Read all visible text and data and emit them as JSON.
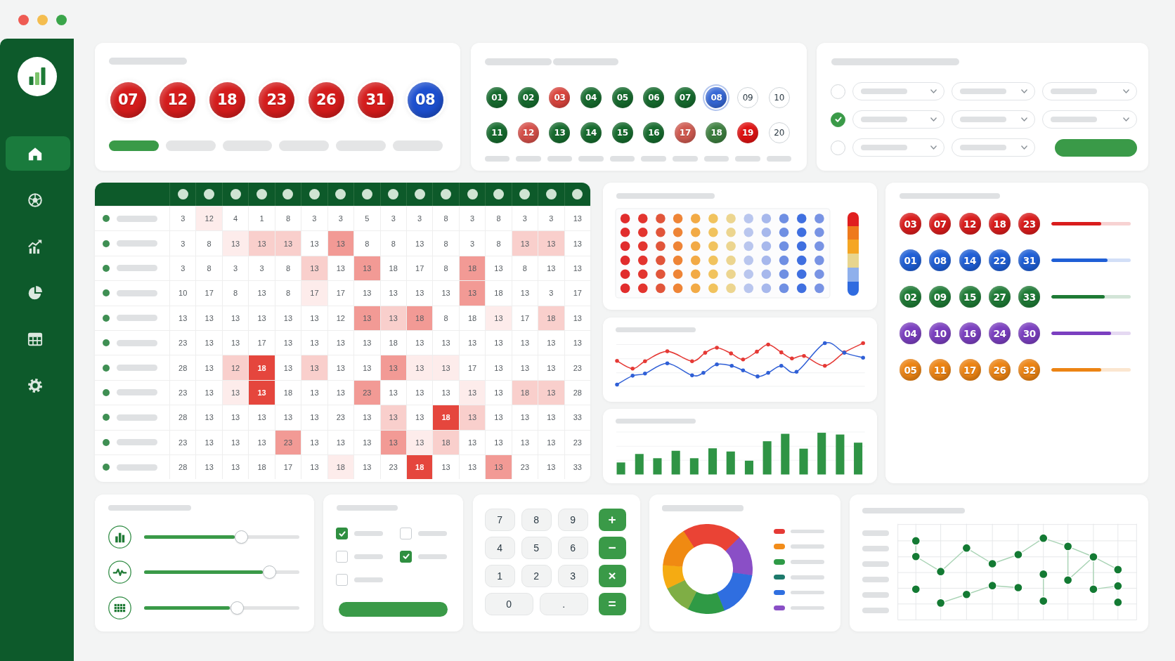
{
  "sidebar": {
    "items": [
      {
        "kind": "home",
        "selected": true
      },
      {
        "kind": "ball",
        "selected": false
      },
      {
        "kind": "trend",
        "selected": false
      },
      {
        "kind": "pie",
        "selected": false
      },
      {
        "kind": "table",
        "selected": false
      },
      {
        "kind": "settings",
        "selected": false
      }
    ]
  },
  "draw_card": {
    "balls": [
      {
        "number": "07",
        "color": "#d41c1c"
      },
      {
        "number": "12",
        "color": "#d41c1c"
      },
      {
        "number": "18",
        "color": "#d41c1c"
      },
      {
        "number": "23",
        "color": "#d41c1c"
      },
      {
        "number": "26",
        "color": "#d41c1c"
      },
      {
        "number": "31",
        "color": "#d41c1c"
      },
      {
        "number": "08",
        "color": "#1d4fcf"
      }
    ],
    "tabs": [
      {
        "selected": true
      },
      {
        "selected": false
      },
      {
        "selected": false
      },
      {
        "selected": false
      },
      {
        "selected": false
      },
      {
        "selected": false
      }
    ]
  },
  "number_grid": {
    "balls": [
      {
        "number": "01",
        "color": "#166b2e",
        "selected": false
      },
      {
        "number": "02",
        "color": "#166b2e",
        "selected": false
      },
      {
        "number": "03",
        "color": "#d9443d",
        "selected": false
      },
      {
        "number": "04",
        "color": "#166b2e",
        "selected": false
      },
      {
        "number": "05",
        "color": "#166b2e",
        "selected": false
      },
      {
        "number": "06",
        "color": "#166b2e",
        "selected": false
      },
      {
        "number": "07",
        "color": "#166b2e",
        "selected": false
      },
      {
        "number": "08",
        "color": "#3567d6",
        "selected": true
      },
      {
        "number": "09",
        "color": "#ffffff",
        "selected": false
      },
      {
        "number": "10",
        "color": "#ffffff",
        "selected": false
      },
      {
        "number": "11",
        "color": "#166b2e",
        "selected": false
      },
      {
        "number": "12",
        "color": "#d6504a",
        "selected": false
      },
      {
        "number": "13",
        "color": "#166b2e",
        "selected": false
      },
      {
        "number": "14",
        "color": "#166b2e",
        "selected": false
      },
      {
        "number": "15",
        "color": "#166b2e",
        "selected": false
      },
      {
        "number": "16",
        "color": "#166b2e",
        "selected": false
      },
      {
        "number": "17",
        "color": "#cf5a50",
        "selected": false
      },
      {
        "number": "18",
        "color": "#3d7f3f",
        "selected": false
      },
      {
        "number": "19",
        "color": "#e01212",
        "selected": false
      },
      {
        "number": "20",
        "color": "#ffffff",
        "selected": false
      }
    ]
  },
  "filter_card": {
    "rows": [
      {
        "selected": false,
        "fields": [
          {
            "kind": "dropdown"
          },
          {
            "kind": "dropdown"
          },
          {
            "kind": "dropdown"
          }
        ]
      },
      {
        "selected": true,
        "fields": [
          {
            "kind": "dropdown"
          },
          {
            "kind": "dropdown"
          },
          {
            "kind": "dropdown"
          }
        ]
      },
      {
        "selected": false,
        "fields": [
          {
            "kind": "dropdown"
          },
          {
            "kind": "dropdown"
          },
          {
            "kind": "button"
          }
        ]
      }
    ]
  },
  "table": {
    "rows": [
      {
        "cells": [
          {
            "value": "3",
            "color": "#ffffff"
          },
          {
            "value": "12",
            "color": "#fdeceb"
          },
          {
            "value": "4",
            "color": "#ffffff"
          },
          {
            "value": "1",
            "color": "#ffffff"
          },
          {
            "value": "8",
            "color": "#ffffff"
          },
          {
            "value": "3",
            "color": "#ffffff"
          },
          {
            "value": "3",
            "color": "#ffffff"
          },
          {
            "value": "5",
            "color": "#ffffff"
          },
          {
            "value": "3",
            "color": "#ffffff"
          },
          {
            "value": "3",
            "color": "#ffffff"
          },
          {
            "value": "8",
            "color": "#ffffff"
          },
          {
            "value": "3",
            "color": "#ffffff"
          },
          {
            "value": "8",
            "color": "#ffffff"
          },
          {
            "value": "3",
            "color": "#ffffff"
          },
          {
            "value": "3",
            "color": "#ffffff"
          },
          {
            "value": "13",
            "color": "#ffffff"
          }
        ]
      },
      {
        "cells": [
          {
            "value": "3",
            "color": "#ffffff"
          },
          {
            "value": "8",
            "color": "#ffffff"
          },
          {
            "value": "13",
            "color": "#fdeceb"
          },
          {
            "value": "13",
            "color": "#f9cfcc"
          },
          {
            "value": "13",
            "color": "#f9cfcc"
          },
          {
            "value": "13",
            "color": "#ffffff"
          },
          {
            "value": "13",
            "color": "#f29a95"
          },
          {
            "value": "8",
            "color": "#ffffff"
          },
          {
            "value": "8",
            "color": "#ffffff"
          },
          {
            "value": "13",
            "color": "#ffffff"
          },
          {
            "value": "8",
            "color": "#ffffff"
          },
          {
            "value": "3",
            "color": "#ffffff"
          },
          {
            "value": "8",
            "color": "#ffffff"
          },
          {
            "value": "13",
            "color": "#f9cfcc"
          },
          {
            "value": "13",
            "color": "#f9cfcc"
          },
          {
            "value": "13",
            "color": "#ffffff"
          }
        ]
      },
      {
        "cells": [
          {
            "value": "3",
            "color": "#ffffff"
          },
          {
            "value": "8",
            "color": "#ffffff"
          },
          {
            "value": "3",
            "color": "#ffffff"
          },
          {
            "value": "3",
            "color": "#ffffff"
          },
          {
            "value": "8",
            "color": "#ffffff"
          },
          {
            "value": "13",
            "color": "#f9cfcc"
          },
          {
            "value": "13",
            "color": "#ffffff"
          },
          {
            "value": "13",
            "color": "#f29a95"
          },
          {
            "value": "18",
            "color": "#ffffff"
          },
          {
            "value": "17",
            "color": "#ffffff"
          },
          {
            "value": "8",
            "color": "#ffffff"
          },
          {
            "value": "18",
            "color": "#f29a95"
          },
          {
            "value": "13",
            "color": "#ffffff"
          },
          {
            "value": "8",
            "color": "#ffffff"
          },
          {
            "value": "13",
            "color": "#ffffff"
          },
          {
            "value": "13",
            "color": "#ffffff"
          }
        ]
      },
      {
        "cells": [
          {
            "value": "10",
            "color": "#ffffff"
          },
          {
            "value": "17",
            "color": "#ffffff"
          },
          {
            "value": "8",
            "color": "#ffffff"
          },
          {
            "value": "13",
            "color": "#ffffff"
          },
          {
            "value": "8",
            "color": "#ffffff"
          },
          {
            "value": "17",
            "color": "#fdeceb"
          },
          {
            "value": "17",
            "color": "#ffffff"
          },
          {
            "value": "13",
            "color": "#ffffff"
          },
          {
            "value": "13",
            "color": "#ffffff"
          },
          {
            "value": "13",
            "color": "#ffffff"
          },
          {
            "value": "13",
            "color": "#ffffff"
          },
          {
            "value": "13",
            "color": "#f29a95"
          },
          {
            "value": "18",
            "color": "#ffffff"
          },
          {
            "value": "13",
            "color": "#ffffff"
          },
          {
            "value": "3",
            "color": "#ffffff"
          },
          {
            "value": "17",
            "color": "#ffffff"
          }
        ]
      },
      {
        "cells": [
          {
            "value": "13",
            "color": "#ffffff"
          },
          {
            "value": "13",
            "color": "#ffffff"
          },
          {
            "value": "13",
            "color": "#ffffff"
          },
          {
            "value": "13",
            "color": "#ffffff"
          },
          {
            "value": "13",
            "color": "#ffffff"
          },
          {
            "value": "13",
            "color": "#ffffff"
          },
          {
            "value": "12",
            "color": "#ffffff"
          },
          {
            "value": "13",
            "color": "#f29a95"
          },
          {
            "value": "13",
            "color": "#f9cfcc"
          },
          {
            "value": "18",
            "color": "#f29a95"
          },
          {
            "value": "8",
            "color": "#ffffff"
          },
          {
            "value": "18",
            "color": "#ffffff"
          },
          {
            "value": "13",
            "color": "#fdeceb"
          },
          {
            "value": "17",
            "color": "#ffffff"
          },
          {
            "value": "18",
            "color": "#f9cfcc"
          },
          {
            "value": "13",
            "color": "#ffffff"
          }
        ]
      },
      {
        "cells": [
          {
            "value": "23",
            "color": "#ffffff"
          },
          {
            "value": "13",
            "color": "#ffffff"
          },
          {
            "value": "13",
            "color": "#ffffff"
          },
          {
            "value": "17",
            "color": "#ffffff"
          },
          {
            "value": "13",
            "color": "#ffffff"
          },
          {
            "value": "13",
            "color": "#ffffff"
          },
          {
            "value": "13",
            "color": "#ffffff"
          },
          {
            "value": "13",
            "color": "#ffffff"
          },
          {
            "value": "18",
            "color": "#ffffff"
          },
          {
            "value": "13",
            "color": "#ffffff"
          },
          {
            "value": "13",
            "color": "#ffffff"
          },
          {
            "value": "13",
            "color": "#ffffff"
          },
          {
            "value": "13",
            "color": "#ffffff"
          },
          {
            "value": "13",
            "color": "#ffffff"
          },
          {
            "value": "13",
            "color": "#ffffff"
          },
          {
            "value": "13",
            "color": "#ffffff"
          }
        ]
      },
      {
        "cells": [
          {
            "value": "28",
            "color": "#ffffff"
          },
          {
            "value": "13",
            "color": "#ffffff"
          },
          {
            "value": "12",
            "color": "#f9cfcc"
          },
          {
            "value": "18",
            "color": "#e5463d"
          },
          {
            "value": "13",
            "color": "#ffffff"
          },
          {
            "value": "13",
            "color": "#f9cfcc"
          },
          {
            "value": "13",
            "color": "#ffffff"
          },
          {
            "value": "13",
            "color": "#ffffff"
          },
          {
            "value": "13",
            "color": "#f29a95"
          },
          {
            "value": "13",
            "color": "#fdeceb"
          },
          {
            "value": "13",
            "color": "#fdeceb"
          },
          {
            "value": "17",
            "color": "#ffffff"
          },
          {
            "value": "13",
            "color": "#ffffff"
          },
          {
            "value": "13",
            "color": "#ffffff"
          },
          {
            "value": "13",
            "color": "#ffffff"
          },
          {
            "value": "23",
            "color": "#ffffff"
          }
        ]
      },
      {
        "cells": [
          {
            "value": "23",
            "color": "#ffffff"
          },
          {
            "value": "13",
            "color": "#ffffff"
          },
          {
            "value": "13",
            "color": "#fdeceb"
          },
          {
            "value": "13",
            "color": "#e5463d"
          },
          {
            "value": "18",
            "color": "#ffffff"
          },
          {
            "value": "13",
            "color": "#ffffff"
          },
          {
            "value": "13",
            "color": "#ffffff"
          },
          {
            "value": "23",
            "color": "#f29a95"
          },
          {
            "value": "13",
            "color": "#ffffff"
          },
          {
            "value": "13",
            "color": "#ffffff"
          },
          {
            "value": "13",
            "color": "#ffffff"
          },
          {
            "value": "13",
            "color": "#fdeceb"
          },
          {
            "value": "13",
            "color": "#ffffff"
          },
          {
            "value": "18",
            "color": "#f9cfcc"
          },
          {
            "value": "13",
            "color": "#f9cfcc"
          },
          {
            "value": "28",
            "color": "#ffffff"
          }
        ]
      },
      {
        "cells": [
          {
            "value": "28",
            "color": "#ffffff"
          },
          {
            "value": "13",
            "color": "#ffffff"
          },
          {
            "value": "13",
            "color": "#ffffff"
          },
          {
            "value": "13",
            "color": "#ffffff"
          },
          {
            "value": "13",
            "color": "#ffffff"
          },
          {
            "value": "13",
            "color": "#ffffff"
          },
          {
            "value": "23",
            "color": "#ffffff"
          },
          {
            "value": "13",
            "color": "#ffffff"
          },
          {
            "value": "13",
            "color": "#f9cfcc"
          },
          {
            "value": "13",
            "color": "#ffffff"
          },
          {
            "value": "18",
            "color": "#e5463d"
          },
          {
            "value": "13",
            "color": "#f9cfcc"
          },
          {
            "value": "13",
            "color": "#ffffff"
          },
          {
            "value": "13",
            "color": "#ffffff"
          },
          {
            "value": "13",
            "color": "#ffffff"
          },
          {
            "value": "33",
            "color": "#ffffff"
          }
        ]
      },
      {
        "cells": [
          {
            "value": "23",
            "color": "#ffffff"
          },
          {
            "value": "13",
            "color": "#ffffff"
          },
          {
            "value": "13",
            "color": "#ffffff"
          },
          {
            "value": "13",
            "color": "#ffffff"
          },
          {
            "value": "23",
            "color": "#f29a95"
          },
          {
            "value": "13",
            "color": "#ffffff"
          },
          {
            "value": "13",
            "color": "#ffffff"
          },
          {
            "value": "13",
            "color": "#ffffff"
          },
          {
            "value": "13",
            "color": "#f29a95"
          },
          {
            "value": "13",
            "color": "#fdeceb"
          },
          {
            "value": "18",
            "color": "#f9cfcc"
          },
          {
            "value": "13",
            "color": "#ffffff"
          },
          {
            "value": "13",
            "color": "#ffffff"
          },
          {
            "value": "13",
            "color": "#ffffff"
          },
          {
            "value": "13",
            "color": "#ffffff"
          },
          {
            "value": "23",
            "color": "#ffffff"
          }
        ]
      },
      {
        "cells": [
          {
            "value": "28",
            "color": "#ffffff"
          },
          {
            "value": "13",
            "color": "#ffffff"
          },
          {
            "value": "13",
            "color": "#ffffff"
          },
          {
            "value": "18",
            "color": "#ffffff"
          },
          {
            "value": "17",
            "color": "#ffffff"
          },
          {
            "value": "13",
            "color": "#ffffff"
          },
          {
            "value": "18",
            "color": "#fdeceb"
          },
          {
            "value": "13",
            "color": "#ffffff"
          },
          {
            "value": "23",
            "color": "#ffffff"
          },
          {
            "value": "18",
            "color": "#e5463d"
          },
          {
            "value": "13",
            "color": "#ffffff"
          },
          {
            "value": "13",
            "color": "#ffffff"
          },
          {
            "value": "13",
            "color": "#f29a95"
          },
          {
            "value": "23",
            "color": "#ffffff"
          },
          {
            "value": "13",
            "color": "#ffffff"
          },
          {
            "value": "33",
            "color": "#ffffff"
          }
        ]
      }
    ]
  },
  "number_groups": {
    "groups": [
      {
        "color": "#d91c1c",
        "numbers": [
          "03",
          "07",
          "12",
          "18",
          "23"
        ],
        "level": 0.63
      },
      {
        "color": "#1f5fd6",
        "numbers": [
          "01",
          "08",
          "14",
          "22",
          "31"
        ],
        "level": 0.71
      },
      {
        "color": "#1e7a35",
        "numbers": [
          "02",
          "09",
          "15",
          "27",
          "33"
        ],
        "level": 0.67
      },
      {
        "color": "#7b3fc0",
        "numbers": [
          "04",
          "10",
          "16",
          "24",
          "30"
        ],
        "level": 0.75
      },
      {
        "color": "#ec8414",
        "numbers": [
          "05",
          "11",
          "17",
          "26",
          "32"
        ],
        "level": 0.63
      }
    ]
  },
  "sliders": [
    {
      "kind": "bars",
      "level": 0.63
    },
    {
      "kind": "pulse",
      "level": 0.81
    },
    {
      "kind": "grid",
      "level": 0.6
    }
  ],
  "checkboxes": [
    {
      "checked": true
    },
    {
      "checked": false
    },
    {
      "checked": false
    },
    {
      "checked": true
    },
    {
      "checked": false
    }
  ],
  "keypad": {
    "rows": [
      {
        "keys": [
          {
            "label": "7",
            "kind": "digit"
          },
          {
            "label": "8",
            "kind": "digit"
          },
          {
            "label": "9",
            "kind": "digit"
          },
          {
            "label": "+",
            "kind": "operator"
          }
        ]
      },
      {
        "keys": [
          {
            "label": "4",
            "kind": "digit"
          },
          {
            "label": "5",
            "kind": "digit"
          },
          {
            "label": "6",
            "kind": "digit"
          },
          {
            "label": "−",
            "kind": "operator"
          }
        ]
      },
      {
        "keys": [
          {
            "label": "1",
            "kind": "digit"
          },
          {
            "label": "2",
            "kind": "digit"
          },
          {
            "label": "3",
            "kind": "digit"
          },
          {
            "label": "×",
            "kind": "operator"
          }
        ]
      },
      {
        "keys": [
          {
            "label": "0",
            "kind": "digit"
          },
          {
            "label": ".",
            "kind": "digit"
          },
          {
            "label": "=",
            "kind": "operator"
          }
        ]
      }
    ]
  },
  "donut_legend": [
    {
      "color": "#e53935"
    },
    {
      "color": "#f28c1a"
    },
    {
      "color": "#2e9a46"
    },
    {
      "color": "#1d7a6c"
    },
    {
      "color": "#2f6fe0"
    },
    {
      "color": "#8a4fc6"
    }
  ]
}
